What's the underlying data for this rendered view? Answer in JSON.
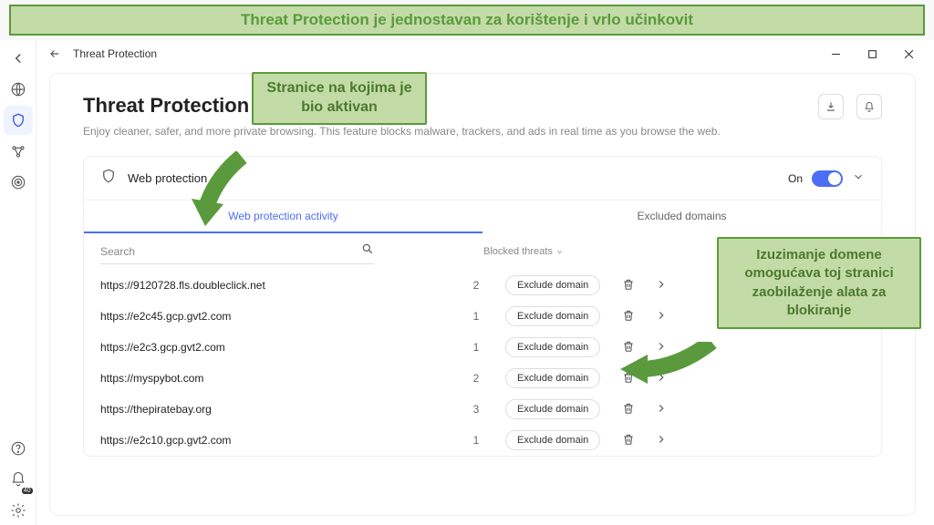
{
  "banner": "Threat Protection je jednostavan za korištenje i vrlo učinkovit",
  "callout1": "Stranice na kojima je bio aktivan",
  "callout2": "Izuzimanje domene omogućava toj stranici zaobilaženje alata za blokiranje",
  "titlebar": {
    "title": "Threat Protection"
  },
  "page": {
    "title": "Threat Protection",
    "subtitle": "Enjoy cleaner, safer, and more private browsing. This feature blocks malware, trackers, and ads in real time as you browse the web."
  },
  "section": {
    "label": "Web protection",
    "state": "On"
  },
  "tabs": {
    "activity": "Web protection activity",
    "excluded": "Excluded domains"
  },
  "search": {
    "placeholder": "Search"
  },
  "blocked_header": "Blocked threats",
  "exclude_label": "Exclude domain",
  "rows": [
    {
      "url": "https://9120728.fls.doubleclick.net",
      "count": 2
    },
    {
      "url": "https://e2c45.gcp.gvt2.com",
      "count": 1
    },
    {
      "url": "https://e2c3.gcp.gvt2.com",
      "count": 1
    },
    {
      "url": "https://myspybot.com",
      "count": 2
    },
    {
      "url": "https://thepiratebay.org",
      "count": 3
    },
    {
      "url": "https://e2c10.gcp.gvt2.com",
      "count": 1
    }
  ],
  "notif_badge": "40"
}
